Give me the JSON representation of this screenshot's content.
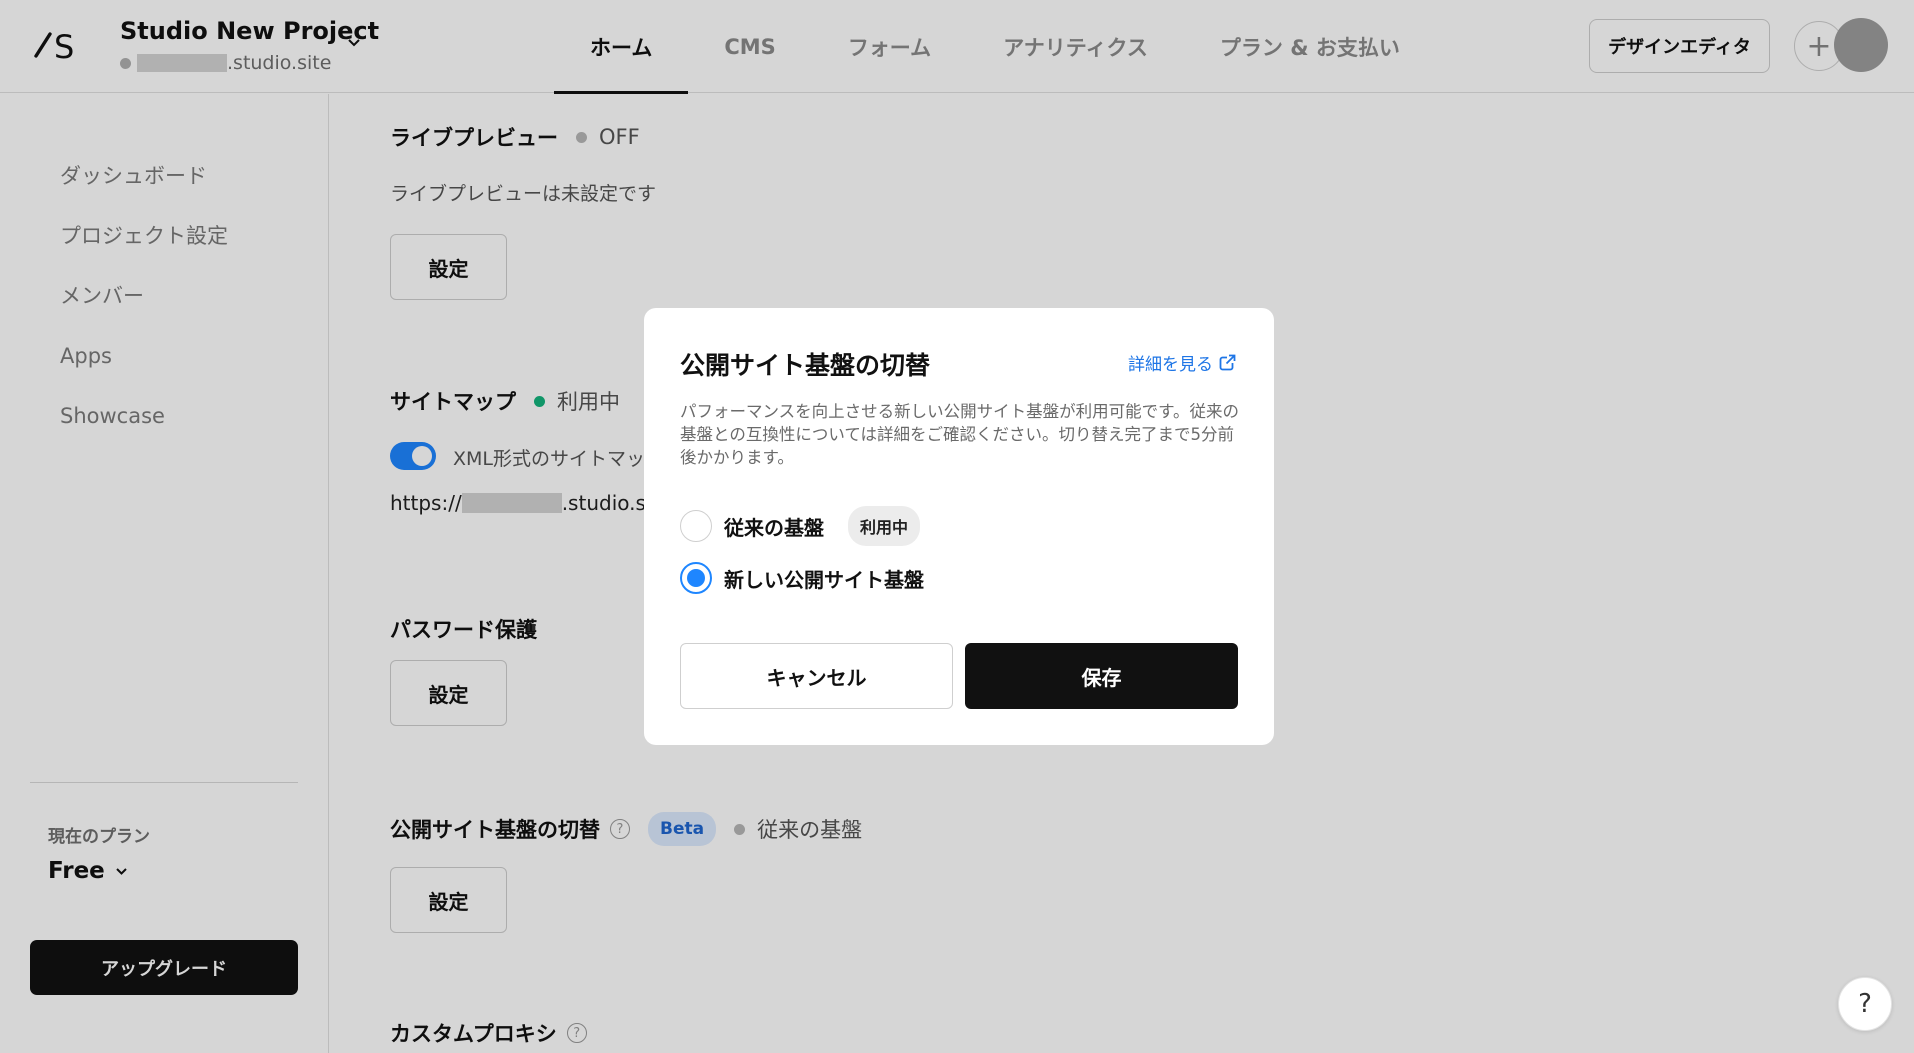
{
  "header": {
    "project_name": "Studio New Project",
    "project_domain": ".studio.site",
    "nav_tabs": [
      {
        "label": "ホーム"
      },
      {
        "label": "CMS"
      },
      {
        "label": "フォーム"
      },
      {
        "label": "アナリティクス"
      },
      {
        "label": "プラン & お支払い"
      }
    ],
    "active_tab": "ホーム",
    "design_editor_label": "デザインエディタ",
    "plus_label": "+"
  },
  "sidebar": {
    "items": [
      {
        "label": "ダッシュボード"
      },
      {
        "label": "プロジェクト設定"
      },
      {
        "label": "メンバー"
      },
      {
        "label": "Apps"
      },
      {
        "label": "Showcase"
      }
    ],
    "plan_label": "現在のプラン",
    "plan_value": "Free",
    "upgrade_label": "アップグレード"
  },
  "main": {
    "live_preview": {
      "title": "ライブプレビュー",
      "status": "OFF",
      "description": "ライブプレビューは未設定です",
      "button": "設定"
    },
    "sitemap": {
      "title": "サイトマップ",
      "status": "利用中",
      "toggle_label": "XML形式のサイトマップ",
      "url_prefix": "https://",
      "url_suffix": ".studio.s"
    },
    "password": {
      "title": "パスワード保護",
      "button": "設定"
    },
    "switch": {
      "title": "公開サイト基盤の切替",
      "badge": "Beta",
      "status": "従来の基盤",
      "button": "設定"
    },
    "custom_proxy": {
      "title": "カスタムプロキシ"
    }
  },
  "modal": {
    "title": "公開サイト基盤の切替",
    "link": "詳細を見る",
    "body": "パフォーマンスを向上させる新しい公開サイト基盤が利用可能です。従来の基盤との互換性については詳細をご確認ください。切り替え完了まで5分前後かかります。",
    "options": [
      {
        "label": "従来の基盤",
        "badge": "利用中",
        "selected": false
      },
      {
        "label": "新しい公開サイト基盤",
        "selected": true
      }
    ],
    "cancel": "キャンセル",
    "save": "保存"
  },
  "help_button": "?",
  "colors": {
    "accent": "#1e86ff",
    "status_active": "#14b37d",
    "primary_button": "#111111",
    "link": "#1e75e6"
  }
}
